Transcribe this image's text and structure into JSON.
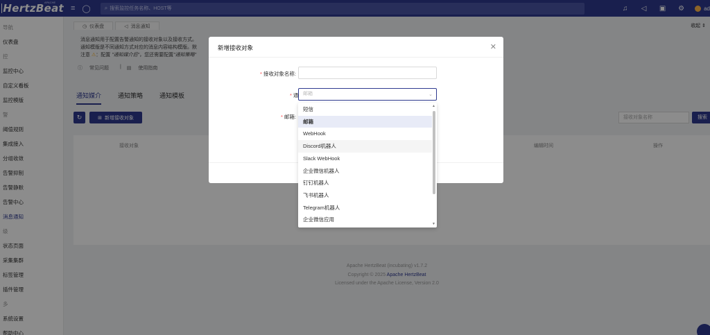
{
  "topbar": {
    "logo_text": "HertzBeat",
    "logo_tag": "APACHE",
    "search_placeholder": "搜索监控任务名称、HOST等",
    "user": "ad"
  },
  "sidebar": {
    "rows": [
      {
        "label": "导航",
        "type": "group"
      },
      {
        "label": "仪表盘",
        "type": "item"
      },
      {
        "label": "控",
        "type": "group"
      },
      {
        "label": "监控中心",
        "type": "item"
      },
      {
        "label": "自定义看板",
        "type": "item"
      },
      {
        "label": "监控模版",
        "type": "item"
      },
      {
        "label": "警",
        "type": "group"
      },
      {
        "label": "阈值规则",
        "type": "item"
      },
      {
        "label": "集成接入",
        "type": "item"
      },
      {
        "label": "分组收敛",
        "type": "item"
      },
      {
        "label": "告警抑制",
        "type": "item"
      },
      {
        "label": "告警静默",
        "type": "item"
      },
      {
        "label": "告警中心",
        "type": "item"
      },
      {
        "label": "消息通知",
        "type": "active"
      },
      {
        "label": "级",
        "type": "group"
      },
      {
        "label": "状态页面",
        "type": "item"
      },
      {
        "label": "采集集群",
        "type": "item"
      },
      {
        "label": "标签管理",
        "type": "item"
      },
      {
        "label": "插件管理",
        "type": "item"
      },
      {
        "label": "多",
        "type": "group"
      },
      {
        "label": "系统设置",
        "type": "item"
      },
      {
        "label": "帮助中心",
        "type": "item"
      }
    ]
  },
  "page_tabs": {
    "dashboard": "仪表盘",
    "notice": "消息通知",
    "collapse": "收起"
  },
  "notice_text": {
    "line1": "消息通知用于配置告警通知的接收对象以及接收方式。",
    "line2": "通知模版是不同通知方式对应的消息内容结构模版。默",
    "line3_pre": "注意",
    "line3_a": "配置",
    "line3_b": "\"通知媒介后\"",
    "line3_c": "，您还需要配置",
    "line3_d": "\"通知策略\""
  },
  "help": {
    "faq": "常见问题",
    "guide": "使用指南"
  },
  "media_tabs": [
    "通知媒介",
    "通知策略",
    "通知模板"
  ],
  "toolbar": {
    "add_label": "新增接收对象",
    "filter_placeholder": "接收对象名称",
    "search_label": "搜索"
  },
  "table": {
    "col_receiver": "接收对象",
    "col_time": "编辑时间",
    "col_actions": "操作"
  },
  "footer": {
    "line1": "Apache HertzBeat (incubating) v1.7.2",
    "line2_pre": "Copyright © 2025",
    "line2_link": "Apache HertzBeat",
    "line3": "Licensed under the Apache License, Version 2.0"
  },
  "modal": {
    "title": "新增接收对象",
    "name_label": "接收对象名称",
    "method_label": "通知方式",
    "method_value": "邮箱",
    "email_label": "邮箱"
  },
  "dropdown": {
    "options": [
      "短信",
      "邮箱",
      "WebHook",
      "Discord机器人",
      "Slack WebHook",
      "企业微信机器人",
      "钉钉机器人",
      "飞书机器人",
      "Telegram机器人",
      "企业微信应用"
    ],
    "selected": "邮箱"
  },
  "colors": {
    "primary": "#2f3a8f",
    "required": "#ff4d4f",
    "warning": "#faad14"
  }
}
